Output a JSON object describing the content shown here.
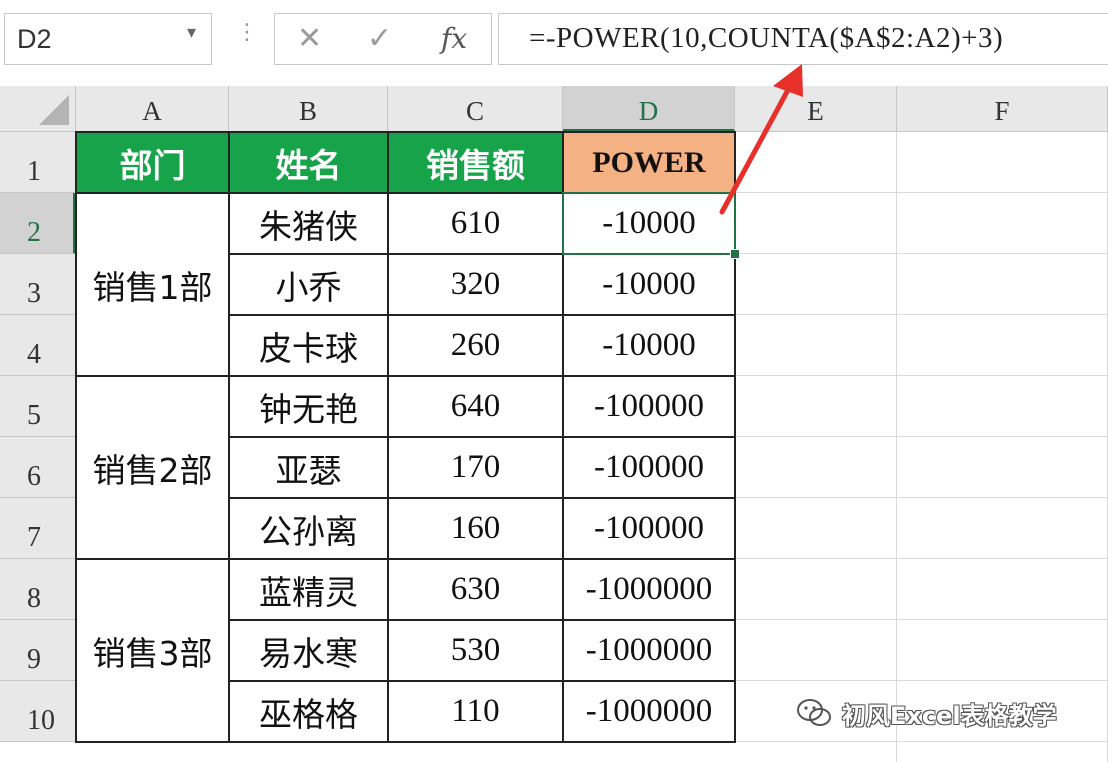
{
  "name_box": {
    "value": "D2"
  },
  "formula_bar": {
    "cancel_glyph": "✕",
    "enter_glyph": "✓",
    "fx_label": "fx",
    "formula": "=-POWER(10,COUNTA($A$2:A2)+3)"
  },
  "columns": [
    "A",
    "B",
    "C",
    "D",
    "E",
    "F"
  ],
  "rows": [
    "1",
    "2",
    "3",
    "4",
    "5",
    "6",
    "7",
    "8",
    "9",
    "10"
  ],
  "table": {
    "headers": [
      "部门",
      "姓名",
      "销售额",
      "POWER"
    ],
    "departments": [
      "销售1部",
      "销售2部",
      "销售3部"
    ],
    "records": [
      {
        "name": "朱猪侠",
        "sales": "610",
        "power": "-10000"
      },
      {
        "name": "小乔",
        "sales": "320",
        "power": "-10000"
      },
      {
        "name": "皮卡球",
        "sales": "260",
        "power": "-10000"
      },
      {
        "name": "钟无艳",
        "sales": "640",
        "power": "-100000"
      },
      {
        "name": "亚瑟",
        "sales": "170",
        "power": "-100000"
      },
      {
        "name": "公孙离",
        "sales": "160",
        "power": "-100000"
      },
      {
        "name": "蓝精灵",
        "sales": "630",
        "power": "-1000000"
      },
      {
        "name": "易水寒",
        "sales": "530",
        "power": "-1000000"
      },
      {
        "name": "巫格格",
        "sales": "110",
        "power": "-1000000"
      }
    ]
  },
  "selected_cell": "D2",
  "colors": {
    "header_green": "#16a34a",
    "power_header_orange": "#f4b183",
    "selection_green": "#217346",
    "annotation_red": "#e8302a"
  },
  "watermark": {
    "text": "初风Excel表格教学"
  }
}
